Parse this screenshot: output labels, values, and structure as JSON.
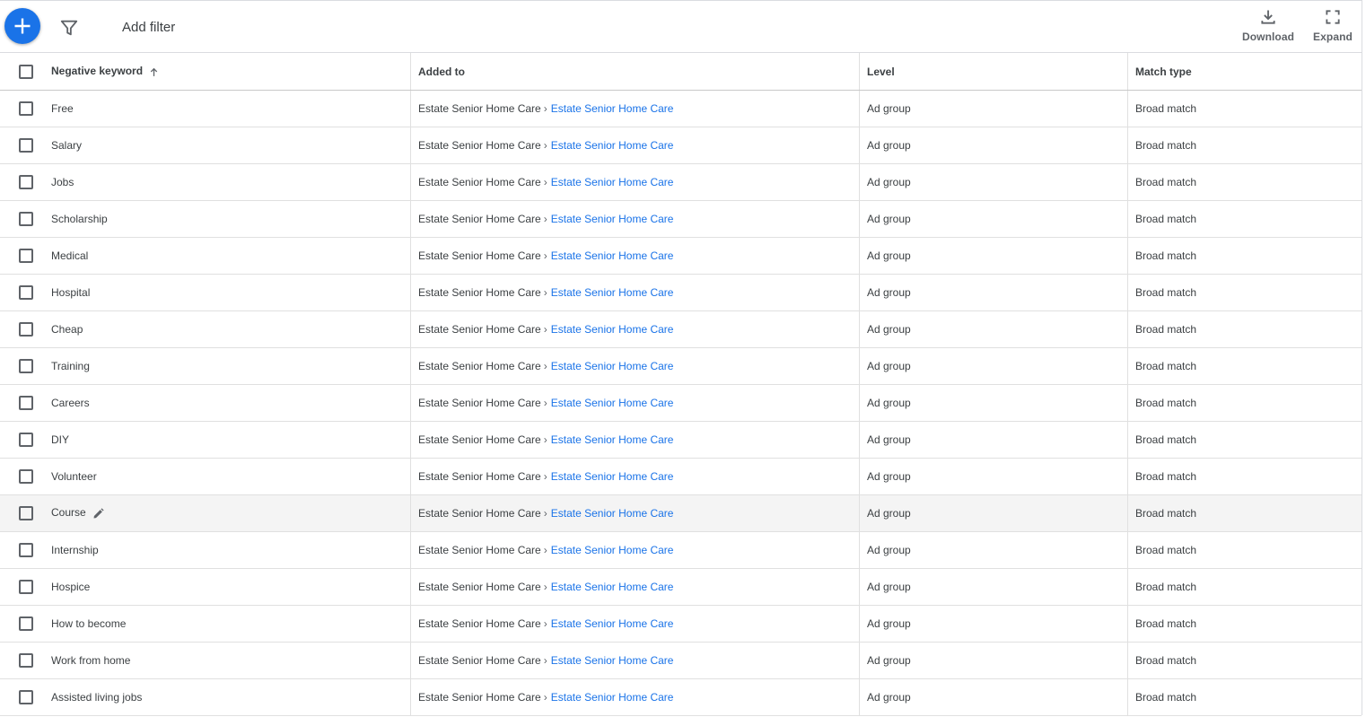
{
  "toolbar": {
    "add_filter_label": "Add filter",
    "download_label": "Download",
    "expand_label": "Expand",
    "accent_color": "#1a73e8"
  },
  "table": {
    "columns": {
      "keyword": "Negative keyword",
      "added_to": "Added to",
      "level": "Level",
      "match_type": "Match type"
    },
    "sort": {
      "column": "keyword",
      "direction": "ascending",
      "icon": "arrow-up-icon"
    },
    "rows": [
      {
        "keyword": "Free",
        "campaign": "Estate Senior Home Care",
        "ad_group": "Estate Senior Home Care",
        "level": "Ad group",
        "match_type": "Broad match"
      },
      {
        "keyword": "Salary",
        "campaign": "Estate Senior Home Care",
        "ad_group": "Estate Senior Home Care",
        "level": "Ad group",
        "match_type": "Broad match"
      },
      {
        "keyword": "Jobs",
        "campaign": "Estate Senior Home Care",
        "ad_group": "Estate Senior Home Care",
        "level": "Ad group",
        "match_type": "Broad match"
      },
      {
        "keyword": "Scholarship",
        "campaign": "Estate Senior Home Care",
        "ad_group": "Estate Senior Home Care",
        "level": "Ad group",
        "match_type": "Broad match"
      },
      {
        "keyword": "Medical",
        "campaign": "Estate Senior Home Care",
        "ad_group": "Estate Senior Home Care",
        "level": "Ad group",
        "match_type": "Broad match"
      },
      {
        "keyword": "Hospital",
        "campaign": "Estate Senior Home Care",
        "ad_group": "Estate Senior Home Care",
        "level": "Ad group",
        "match_type": "Broad match"
      },
      {
        "keyword": "Cheap",
        "campaign": "Estate Senior Home Care",
        "ad_group": "Estate Senior Home Care",
        "level": "Ad group",
        "match_type": "Broad match"
      },
      {
        "keyword": "Training",
        "campaign": "Estate Senior Home Care",
        "ad_group": "Estate Senior Home Care",
        "level": "Ad group",
        "match_type": "Broad match"
      },
      {
        "keyword": "Careers",
        "campaign": "Estate Senior Home Care",
        "ad_group": "Estate Senior Home Care",
        "level": "Ad group",
        "match_type": "Broad match"
      },
      {
        "keyword": "DIY",
        "campaign": "Estate Senior Home Care",
        "ad_group": "Estate Senior Home Care",
        "level": "Ad group",
        "match_type": "Broad match"
      },
      {
        "keyword": "Volunteer",
        "campaign": "Estate Senior Home Care",
        "ad_group": "Estate Senior Home Care",
        "level": "Ad group",
        "match_type": "Broad match"
      },
      {
        "keyword": "Course",
        "campaign": "Estate Senior Home Care",
        "ad_group": "Estate Senior Home Care",
        "level": "Ad group",
        "match_type": "Broad match"
      },
      {
        "keyword": "Internship",
        "campaign": "Estate Senior Home Care",
        "ad_group": "Estate Senior Home Care",
        "level": "Ad group",
        "match_type": "Broad match"
      },
      {
        "keyword": "Hospice",
        "campaign": "Estate Senior Home Care",
        "ad_group": "Estate Senior Home Care",
        "level": "Ad group",
        "match_type": "Broad match"
      },
      {
        "keyword": "How to become",
        "campaign": "Estate Senior Home Care",
        "ad_group": "Estate Senior Home Care",
        "level": "Ad group",
        "match_type": "Broad match"
      },
      {
        "keyword": "Work from home",
        "campaign": "Estate Senior Home Care",
        "ad_group": "Estate Senior Home Care",
        "level": "Ad group",
        "match_type": "Broad match"
      },
      {
        "keyword": "Assisted living jobs",
        "campaign": "Estate Senior Home Care",
        "ad_group": "Estate Senior Home Care",
        "level": "Ad group",
        "match_type": "Broad match"
      }
    ],
    "hovered_row": 11,
    "breadcrumb_separator": "›"
  }
}
